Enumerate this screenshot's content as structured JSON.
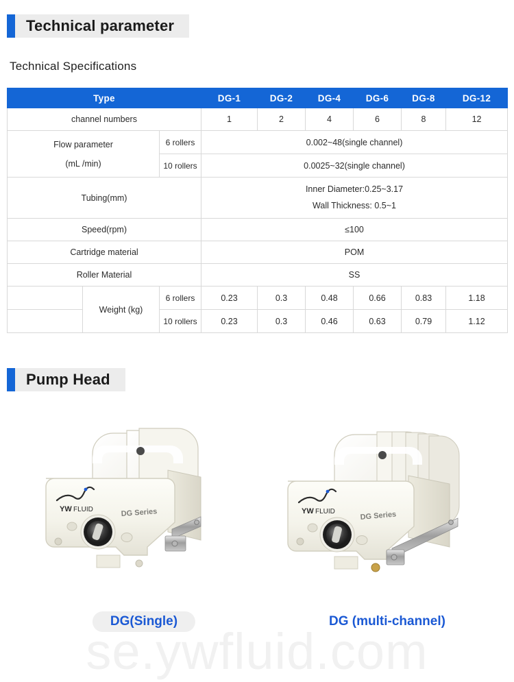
{
  "sections": {
    "technical": {
      "title": "Technical parameter",
      "subtitle": "Technical Specifications"
    },
    "pump_head": {
      "title": "Pump Head"
    }
  },
  "colors": {
    "header_blue": "#1466d6",
    "header_pill": "#ececec",
    "caption_blue": "#1b59d4",
    "table_border": "#d8d8d8"
  },
  "spec_table": {
    "columns": [
      "Type",
      "DG-1",
      "DG-2",
      "DG-4",
      "DG-6",
      "DG-8",
      "DG-12"
    ],
    "rows": {
      "channel_numbers": {
        "label": "channel numbers",
        "values": [
          "1",
          "2",
          "4",
          "6",
          "8",
          "12"
        ]
      },
      "flow_parameter": {
        "label_line1": "Flow parameter",
        "label_line2": "(mL /min)",
        "sub_6_rollers": "6 rollers",
        "sub_10_rollers": "10 rollers",
        "value_6_rollers": "0.002~48(single channel)",
        "value_10_rollers": "0.0025~32(single channel)"
      },
      "tubing": {
        "label": "Tubing(mm)",
        "value_line1": "Inner Diameter:0.25~3.17",
        "value_line2": "Wall Thickness: 0.5~1"
      },
      "speed": {
        "label": "Speed(rpm)",
        "value": "≤100"
      },
      "cartridge_material": {
        "label": "Cartridge material",
        "value": "POM"
      },
      "roller_material": {
        "label": "Roller Material",
        "value": "SS"
      },
      "weight": {
        "label": "Weight (kg)",
        "sub_6_rollers": "6 rollers",
        "sub_10_rollers": "10 rollers",
        "values_6_rollers": [
          "0.23",
          "0.3",
          "0.48",
          "0.66",
          "0.83",
          "1.18"
        ],
        "values_10_rollers": [
          "0.23",
          "0.3",
          "0.46",
          "0.63",
          "0.79",
          "1.12"
        ]
      }
    }
  },
  "gallery": {
    "items": [
      {
        "caption": "DG(Single)",
        "brand_text": "FLUID",
        "series_text": "DG Series"
      },
      {
        "caption": "DG (multi-channel)",
        "brand_text": "FLUID",
        "series_text": "DG Series"
      }
    ]
  },
  "watermark": {
    "text": "se.ywfluid.com",
    "brand": "YW"
  }
}
